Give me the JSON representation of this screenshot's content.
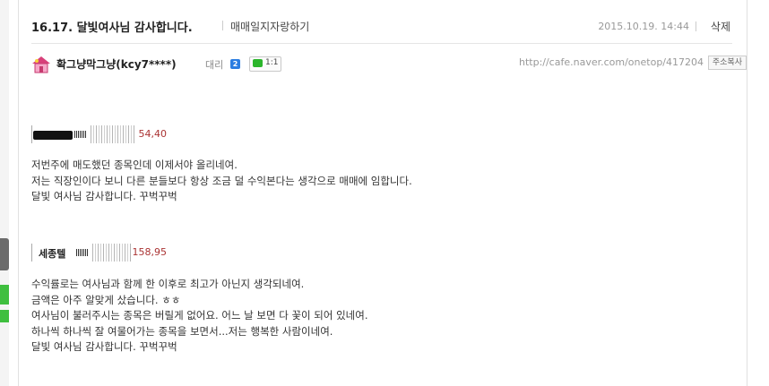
{
  "post": {
    "title": "16.17. 달빛여사님 감사합니다.",
    "board": "매매일지자랑하기",
    "date": "2015.10.19. 14:44",
    "delete_label": "삭제"
  },
  "author": {
    "name": "확그냥막그냥(kcy7****)",
    "level": "대리",
    "level_badge": "2",
    "chat_count": "1:1",
    "url": "http://cafe.naver.com/onetop/417204",
    "copy_url_label": "주소복사"
  },
  "tickers": [
    {
      "name": "",
      "price": "54,40"
    },
    {
      "name": "세종텔",
      "price": "158,95"
    }
  ],
  "paragraph1": [
    "저번주에 매도했던 종목인데 이제서야 올리네여.",
    "저는 직장인이다 보니 다른 분들보다 항상 조금 덜 수익본다는 생각으로 매매에 임합니다.",
    "달빛 여사님 감사합니다. 꾸벅꾸벅"
  ],
  "paragraph2": [
    "수익률로는 여사님과 함께 한 이후로 최고가 아닌지 생각되네여.",
    "금액은 아주 알맞게 샀습니다. ㅎㅎ",
    "여사님이 불러주시는 종목은 버릴게 없어요. 어느 날 보면 다 꽃이 되어 있네여.",
    "하나씩 하나씩 잘 여물어가는 종목을 보면서...저는 행복한 사람이네여.",
    "달빛 여사님 감사합니다. 꾸벅꾸벅"
  ]
}
